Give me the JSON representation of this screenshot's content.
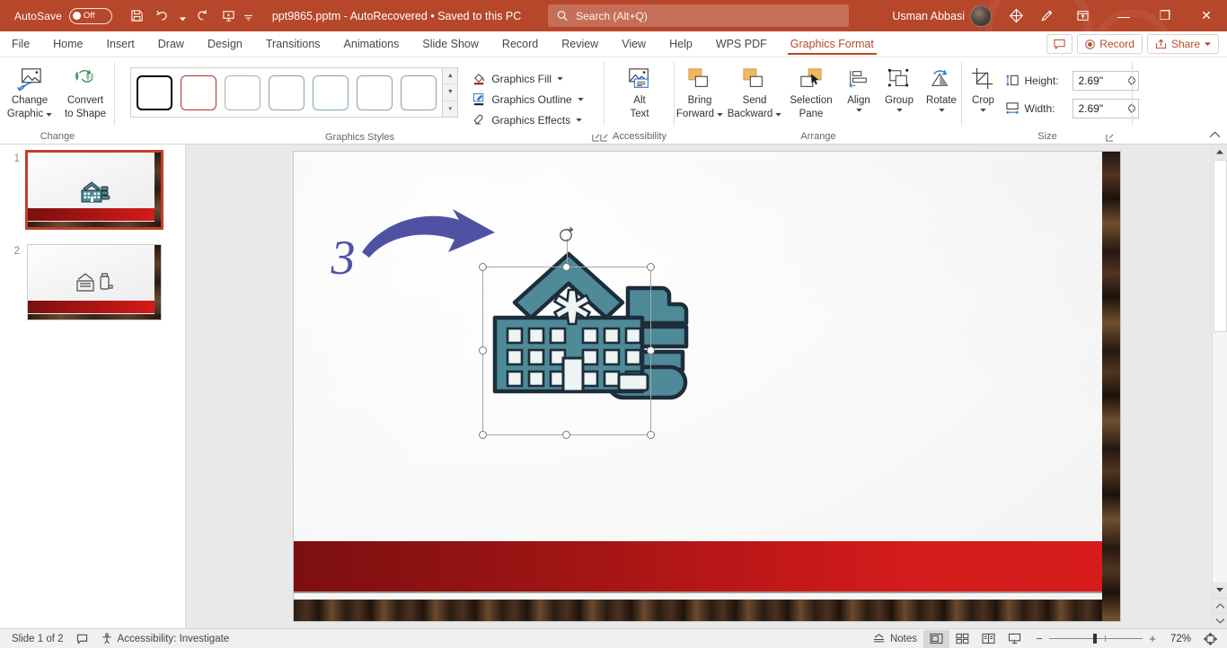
{
  "titlebar": {
    "autosave_label": "AutoSave",
    "autosave_state": "Off",
    "document_title": "ppt9865.pptm  -  AutoRecovered  •  Saved to this PC",
    "quick_access": [
      {
        "name": "save-icon",
        "label": "Save"
      },
      {
        "name": "undo-icon",
        "label": "Undo"
      },
      {
        "name": "undo-dropdown-caret",
        "label": "Undo options"
      },
      {
        "name": "redo-icon",
        "label": "Redo"
      },
      {
        "name": "start-presentation-icon",
        "label": "Start From Beginning"
      },
      {
        "name": "customize-qat-caret",
        "label": "Customize Quick Access Toolbar"
      }
    ],
    "search_placeholder": "Search (Alt+Q)",
    "user_name": "Usman Abbasi",
    "window_buttons": {
      "minimize": "—",
      "restore": "❐",
      "close": "✕"
    }
  },
  "tabs": {
    "items": [
      {
        "label": "File",
        "active": false
      },
      {
        "label": "Home",
        "active": false
      },
      {
        "label": "Insert",
        "active": false
      },
      {
        "label": "Draw",
        "active": false
      },
      {
        "label": "Design",
        "active": false
      },
      {
        "label": "Transitions",
        "active": false
      },
      {
        "label": "Animations",
        "active": false
      },
      {
        "label": "Slide Show",
        "active": false
      },
      {
        "label": "Record",
        "active": false
      },
      {
        "label": "Review",
        "active": false
      },
      {
        "label": "View",
        "active": false
      },
      {
        "label": "Help",
        "active": false
      },
      {
        "label": "WPS PDF",
        "active": false
      },
      {
        "label": "Graphics Format",
        "active": true
      }
    ],
    "right": {
      "comments_label": "",
      "record_label": "Record",
      "share_label": "Share"
    }
  },
  "ribbon": {
    "change_group": {
      "label": "Change",
      "change_graphic": "Change\nGraphic",
      "change_graphic_l1": "Change",
      "change_graphic_l2": "Graphic",
      "convert_l1": "Convert",
      "convert_l2": "to Shape"
    },
    "styles_group": {
      "label": "Graphics Styles",
      "style_swatches": [
        "#000000",
        "#b03030",
        "#b5ad9b",
        "#9aa08e",
        "#7fa5b5",
        "#a795a8",
        "#9a9aa8"
      ],
      "graphics_fill": "Graphics Fill",
      "graphics_outline": "Graphics Outline",
      "graphics_effects": "Graphics Effects",
      "scroll_up": "▲",
      "scroll_down": "▼",
      "scroll_more": "▾"
    },
    "accessibility_group": {
      "label": "Accessibility",
      "alt_text_l1": "Alt",
      "alt_text_l2": "Text"
    },
    "arrange_group": {
      "label": "Arrange",
      "bring_forward_l1": "Bring",
      "bring_forward_l2": "Forward",
      "send_backward_l1": "Send",
      "send_backward_l2": "Backward",
      "selection_pane_l1": "Selection",
      "selection_pane_l2": "Pane",
      "align": "Align",
      "group": "Group",
      "rotate": "Rotate"
    },
    "size_group": {
      "label": "Size",
      "crop": "Crop",
      "height_label": "Height:",
      "height_value": "2.69\"",
      "width_label": "Width:",
      "width_value": "2.69\""
    },
    "collapse_caret": "︿"
  },
  "thumbnails": {
    "slides": [
      {
        "number": "1",
        "selected": true
      },
      {
        "number": "2",
        "selected": false
      }
    ]
  },
  "slide": {
    "step_number": "3",
    "accent_arrow_color": "#4f52a3",
    "graphic_color": "#4e8a97",
    "graphic_outline_color": "#1d2d3a",
    "red_band_color": "#bd1718"
  },
  "status": {
    "slide_counter": "Slide 1 of 2",
    "accessibility": "Accessibility: Investigate",
    "notes_label": "Notes",
    "views": [
      {
        "name": "normal-view",
        "active": true
      },
      {
        "name": "slide-sorter-view",
        "active": false
      },
      {
        "name": "reading-view",
        "active": false
      },
      {
        "name": "slideshow-view",
        "active": false
      }
    ],
    "zoom_out": "−",
    "zoom_in": "+",
    "zoom_level": "72%"
  }
}
